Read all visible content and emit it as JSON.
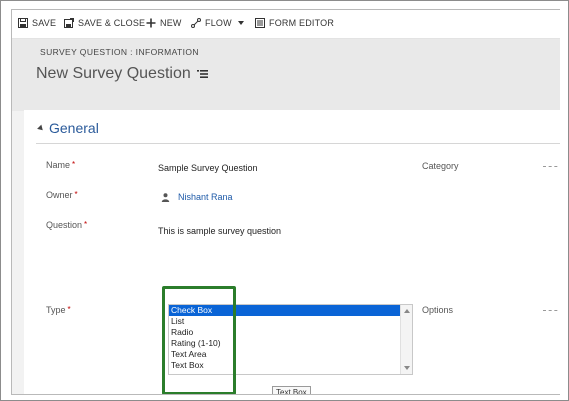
{
  "toolbar": {
    "save": "SAVE",
    "save_close": "SAVE & CLOSE",
    "new": "NEW",
    "flow": "FLOW",
    "form_editor": "FORM EDITOR"
  },
  "header": {
    "entity_label": "SURVEY QUESTION : INFORMATION",
    "record_title": "New Survey Question"
  },
  "section": {
    "title": "General"
  },
  "fields": {
    "name": {
      "label": "Name",
      "required": "*",
      "value": "Sample Survey Question"
    },
    "owner": {
      "label": "Owner",
      "required": "*",
      "value": "Nishant Rana"
    },
    "question": {
      "label": "Question",
      "required": "*",
      "value": "This is sample survey question"
    },
    "type": {
      "label": "Type",
      "required": "*",
      "options": [
        "Check Box",
        "List",
        "Radio",
        "Rating (1-10)",
        "Text Area",
        "Text Box"
      ],
      "selected": "Check Box"
    },
    "category": {
      "label": "Category"
    },
    "options": {
      "label": "Options"
    }
  },
  "tooltip": "Text Box",
  "colors": {
    "accent": "#2a5a9a",
    "highlight_box": "#2b7d2b",
    "selection": "#0a64d6",
    "required": "#c00000"
  }
}
